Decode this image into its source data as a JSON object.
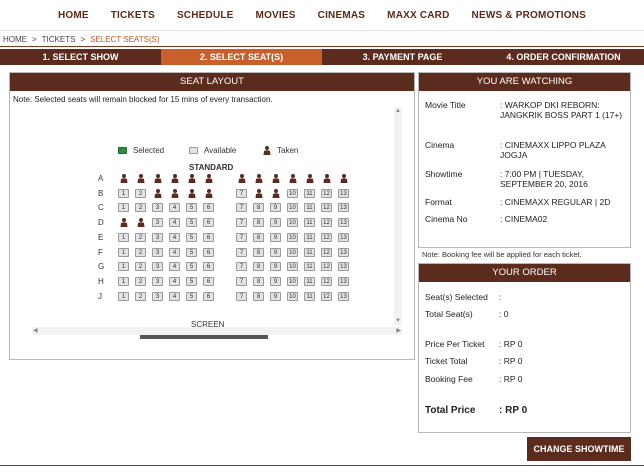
{
  "nav": [
    "HOME",
    "TICKETS",
    "SCHEDULE",
    "MOVIES",
    "CINEMAS",
    "MAXX CARD",
    "NEWS & PROMOTIONS"
  ],
  "breadcrumb": {
    "home": "HOME",
    "tickets": "TICKETS",
    "current": "SELECT SEATS(S)",
    "sep": ">"
  },
  "steps": [
    "1. SELECT SHOW",
    "2. SELECT SEAT(S)",
    "3. PAYMENT PAGE",
    "4. ORDER CONFIRMATION"
  ],
  "active_step": 1,
  "seat_layout": {
    "title": "SEAT LAYOUT",
    "note": "Note: Selected seats will remain blocked for 15 mins of every transaction.",
    "legend": {
      "selected": "Selected",
      "available": "Available",
      "taken": "Taken"
    },
    "section": "STANDARD",
    "screen": "SCREEN",
    "rows": [
      {
        "label": "A",
        "taken": [
          1,
          2,
          3,
          4,
          5,
          6,
          7,
          8,
          9,
          10,
          11,
          12,
          13
        ]
      },
      {
        "label": "B",
        "taken": [
          3,
          4,
          5,
          6,
          8,
          9
        ]
      },
      {
        "label": "C",
        "taken": []
      },
      {
        "label": "D",
        "taken": [
          1,
          2
        ]
      },
      {
        "label": "E",
        "taken": []
      },
      {
        "label": "F",
        "taken": []
      },
      {
        "label": "G",
        "taken": []
      },
      {
        "label": "H",
        "taken": []
      },
      {
        "label": "J",
        "taken": []
      }
    ],
    "seat_numbers": [
      1,
      2,
      3,
      4,
      5,
      6,
      7,
      8,
      9,
      10,
      11,
      12,
      13
    ]
  },
  "watching": {
    "title": "YOU ARE WATCHING",
    "movie_label": "Movie Title",
    "movie": ": WARKOP DKI REBORN: JANGKRIK BOSS PART 1 (17+)",
    "cinema_label": "Cinema",
    "cinema": ": CINEMAXX LIPPO PLAZA JOGJA",
    "showtime_label": "Showtime",
    "showtime": ": 7:00 PM | TUESDAY, SEPTEMBER 20, 2016",
    "format_label": "Format",
    "format": ": CINEMAXX REGULAR | 2D",
    "cinema_no_label": "Cinema No",
    "cinema_no": ": CINEMA02"
  },
  "booking_note": "Note: Booking fee will be applied for each ticket.",
  "order": {
    "title": "YOUR ORDER",
    "seats_selected_label": "Seat(s) Selected",
    "seats_selected": ":",
    "total_seats_label": "Total Seat(s)",
    "total_seats": ": 0",
    "price_label": "Price Per Ticket",
    "price": ": RP 0",
    "ticket_total_label": "Ticket Total",
    "ticket_total": ": RP 0",
    "booking_fee_label": "Booking Fee",
    "booking_fee": ": RP 0",
    "total_price_label": "Total Price",
    "total_price": ": RP 0"
  },
  "change_showtime": "CHANGE SHOWTIME",
  "colors": {
    "brown": "#5b2c1e",
    "orange": "#c8602c",
    "selected_green": "#2e8b3a"
  }
}
